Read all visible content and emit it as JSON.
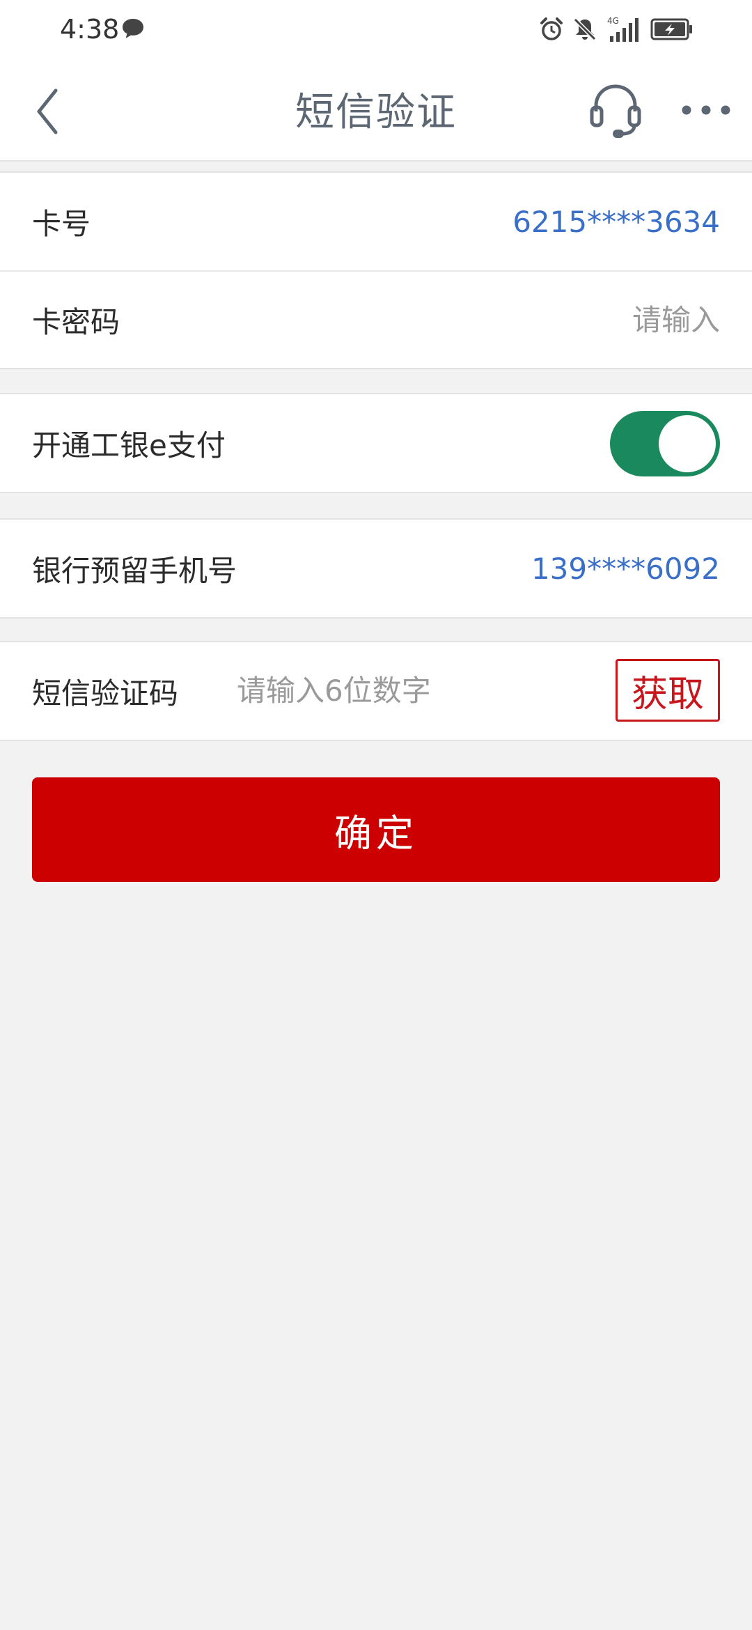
{
  "status_bar": {
    "time": "4:38",
    "network": "4G",
    "icons": [
      "message-icon",
      "alarm-icon",
      "mute-icon",
      "signal-icon",
      "battery-charging-icon"
    ]
  },
  "navbar": {
    "title": "短信验证",
    "back_icon": "chevron-left-icon",
    "support_icon": "headset-icon",
    "more_icon": "more-horizontal-icon"
  },
  "card": {
    "number_label": "卡号",
    "number_value": "6215****3634",
    "password_label": "卡密码",
    "password_placeholder": "请输入"
  },
  "epay": {
    "label": "开通工银e支付",
    "enabled": true
  },
  "phone": {
    "label": "银行预留手机号",
    "value": "139****6092"
  },
  "sms": {
    "label": "短信验证码",
    "placeholder": "请输入6位数字",
    "get_code_label": "获取"
  },
  "confirm": {
    "label": "确定"
  },
  "colors": {
    "accent_red": "#cc0000",
    "link_blue": "#3a6fc9",
    "toggle_green": "#1a8a5e",
    "background": "#f2f2f2"
  }
}
